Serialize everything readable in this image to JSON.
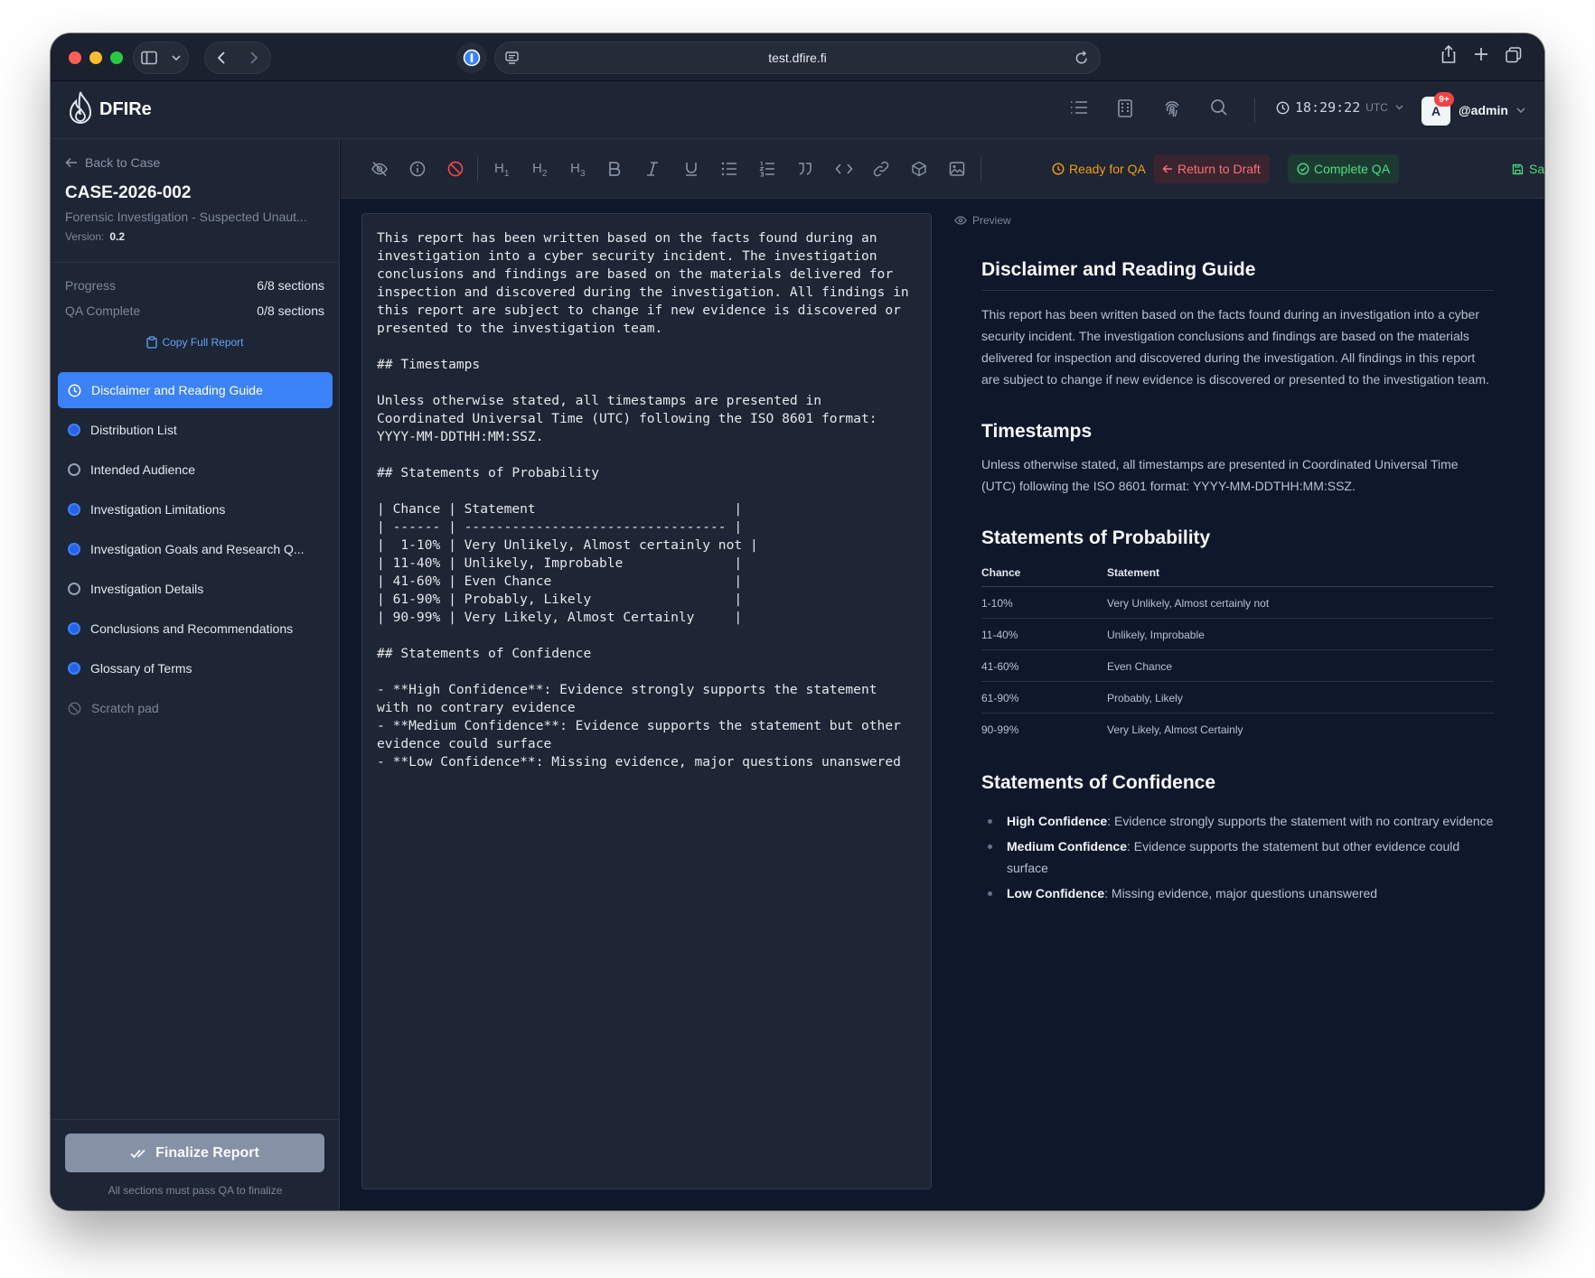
{
  "browser": {
    "url": "test.dfire.fi"
  },
  "app": {
    "name": "DFIRe",
    "clock": "18:29:22",
    "timezone": "UTC",
    "avatar_letter": "A",
    "notifications": "9+",
    "username": "@admin"
  },
  "sidebar": {
    "back_label": "Back to Case",
    "case_id": "CASE-2026-002",
    "case_subtitle": "Forensic Investigation - Suspected Unaut...",
    "version_label": "Version:",
    "version_value": "0.2",
    "progress_label": "Progress",
    "progress_value": "6/8 sections",
    "qa_label": "QA Complete",
    "qa_value": "0/8 sections",
    "copy_label": "Copy Full Report",
    "items": [
      {
        "label": "Disclaimer and Reading Guide",
        "status": "active"
      },
      {
        "label": "Distribution List",
        "status": "filled"
      },
      {
        "label": "Intended Audience",
        "status": "empty"
      },
      {
        "label": "Investigation Limitations",
        "status": "filled"
      },
      {
        "label": "Investigation Goals and Research Q...",
        "status": "filled"
      },
      {
        "label": "Investigation Details",
        "status": "empty"
      },
      {
        "label": "Conclusions and Recommendations",
        "status": "filled"
      },
      {
        "label": "Glossary of Terms",
        "status": "filled"
      },
      {
        "label": "Scratch pad",
        "status": "disabled"
      }
    ],
    "finalize_label": "Finalize Report",
    "finalize_note": "All sections must pass QA to finalize"
  },
  "toolbar": {
    "ready_label": "Ready for QA",
    "return_label": "Return to Draft",
    "complete_label": "Complete QA",
    "saved_label": "Saved"
  },
  "editor": {
    "content": "This report has been written based on the facts found during an investigation into a cyber security incident. The investigation conclusions and findings are based on the materials delivered for inspection and discovered during the investigation. All findings in this report are subject to change if new evidence is discovered or presented to the investigation team.\n\n## Timestamps\n\nUnless otherwise stated, all timestamps are presented in Coordinated Universal Time (UTC) following the ISO 8601 format: YYYY-MM-DDTHH:MM:SSZ.\n\n## Statements of Probability\n\n| Chance | Statement                         |\n| ------ | --------------------------------- |\n|  1-10% | Very Unlikely, Almost certainly not |\n| 11-40% | Unlikely, Improbable              |\n| 41-60% | Even Chance                       |\n| 61-90% | Probably, Likely                  |\n| 90-99% | Very Likely, Almost Certainly     |\n\n## Statements of Confidence\n\n- **High Confidence**: Evidence strongly supports the statement with no contrary evidence\n- **Medium Confidence**: Evidence supports the statement but other evidence could surface\n- **Low Confidence**: Missing evidence, major questions unanswered"
  },
  "preview": {
    "label": "Preview",
    "title": "Disclaimer and Reading Guide",
    "intro": "This report has been written based on the facts found during an investigation into a cyber security incident. The investigation conclusions and findings are based on the materials delivered for inspection and discovered during the investigation. All findings in this report are subject to change if new evidence is discovered or presented to the investigation team.",
    "timestamps_heading": "Timestamps",
    "timestamps_text": "Unless otherwise stated, all timestamps are presented in Coordinated Universal Time (UTC) following the ISO 8601 format: YYYY-MM-DDTHH:MM:SSZ.",
    "probability_heading": "Statements of Probability",
    "table_headers": [
      "Chance",
      "Statement"
    ],
    "table_rows": [
      [
        "1-10%",
        "Very Unlikely, Almost certainly not"
      ],
      [
        "11-40%",
        "Unlikely, Improbable"
      ],
      [
        "41-60%",
        "Even Chance"
      ],
      [
        "61-90%",
        "Probably, Likely"
      ],
      [
        "90-99%",
        "Very Likely, Almost Certainly"
      ]
    ],
    "confidence_heading": "Statements of Confidence",
    "confidence_items": [
      {
        "term": "High Confidence",
        "text": ": Evidence strongly supports the statement with no contrary evidence"
      },
      {
        "term": "Medium Confidence",
        "text": ": Evidence supports the statement but other evidence could surface"
      },
      {
        "term": "Low Confidence",
        "text": ": Missing evidence, major questions unanswered"
      }
    ]
  },
  "colors": {
    "accent": "#3b82f6",
    "background": "#0f172a",
    "panel": "#1e2535",
    "ready": "#f59e0b",
    "return": "#f87171",
    "complete": "#4ade80"
  }
}
